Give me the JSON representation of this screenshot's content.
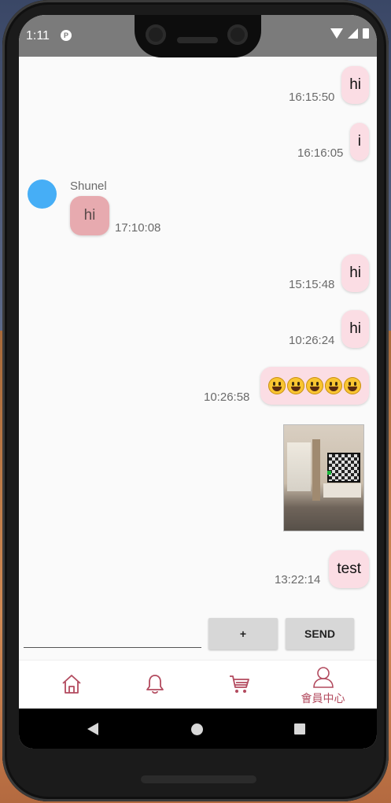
{
  "status_bar": {
    "time": "1:11",
    "app_icon_letter": "P"
  },
  "chat": {
    "outgoing": [
      {
        "text": "hi",
        "time": "16:15:50"
      },
      {
        "text": "i",
        "time": "16:16:05"
      },
      {
        "text": "hi",
        "time": "15:15:48"
      },
      {
        "text": "hi",
        "time": "10:26:24"
      },
      {
        "emoji_name": "grinning-face-icon",
        "emoji_count": 5,
        "time": "10:26:58"
      },
      {
        "image": "living-room-photo"
      },
      {
        "text": "test",
        "time": "13:22:14"
      }
    ],
    "incoming": [
      {
        "sender": "Shunel",
        "text": "hi",
        "time": "17:10:08"
      }
    ]
  },
  "composer": {
    "input_value": "",
    "plus_label": "+",
    "send_label": "SEND"
  },
  "bottom_nav": [
    {
      "icon": "home-icon",
      "label": ""
    },
    {
      "icon": "bell-icon",
      "label": ""
    },
    {
      "icon": "cart-icon",
      "label": ""
    },
    {
      "icon": "user-icon",
      "label": "會員中心"
    }
  ],
  "colors": {
    "outgoing_bubble": "#fbdde4",
    "incoming_bubble": "#e7aaaf",
    "avatar": "#46aef6",
    "nav_accent": "#b24a5e"
  }
}
